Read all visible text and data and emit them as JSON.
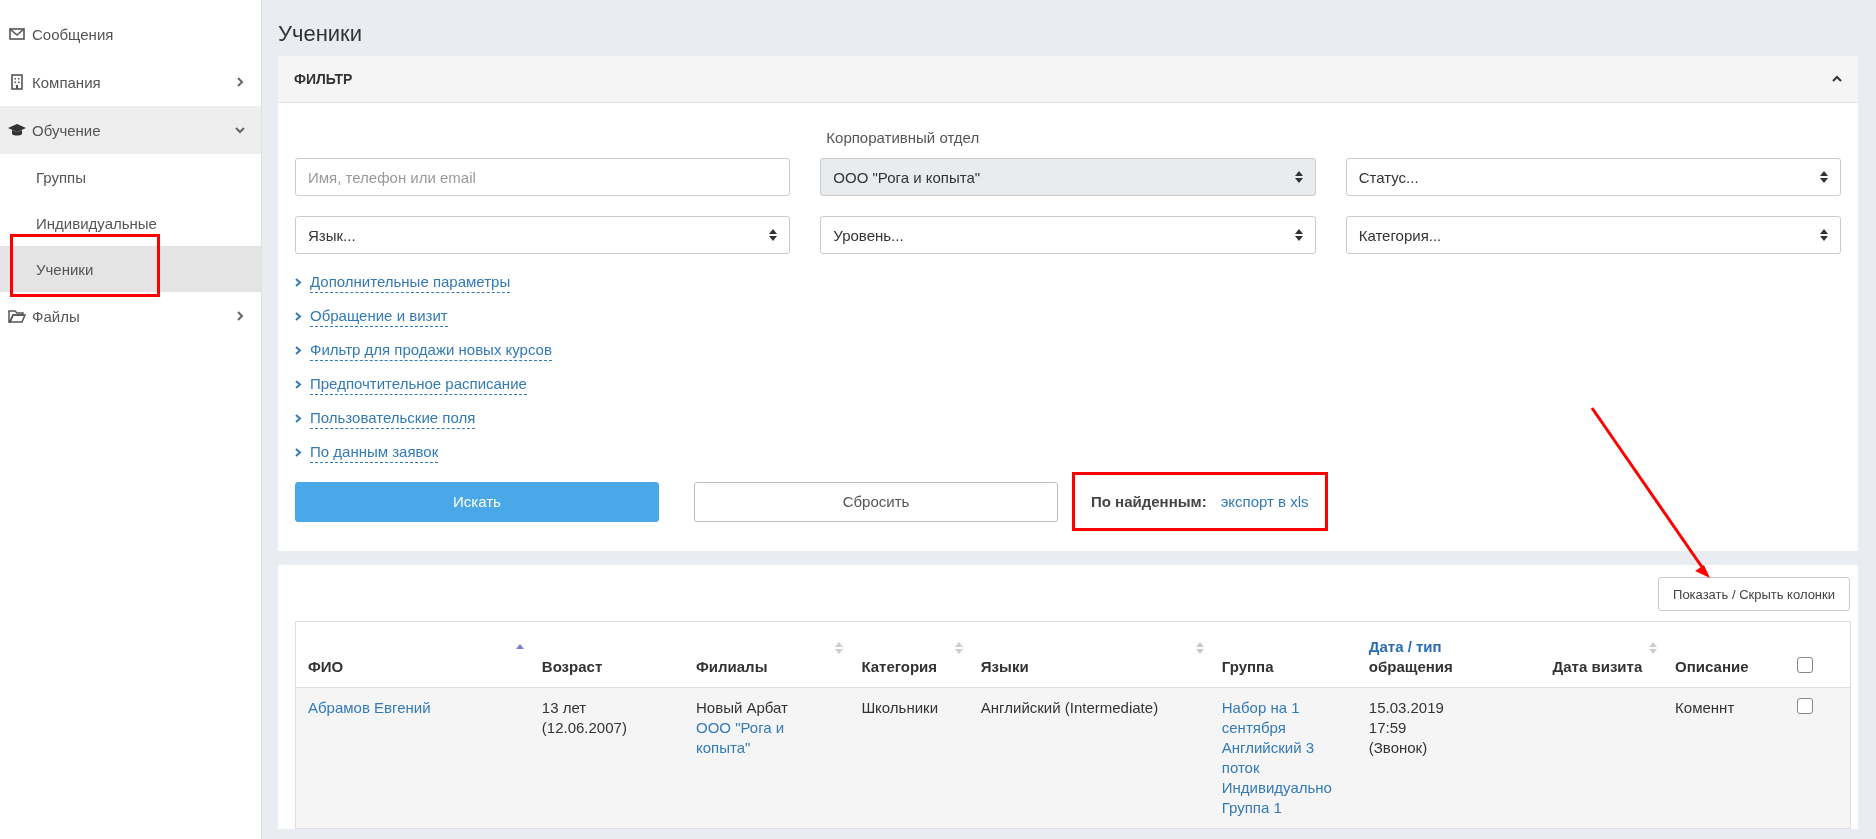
{
  "sidebar": {
    "items": [
      {
        "label": "Сообщения",
        "kind": "link",
        "selected": false
      },
      {
        "label": "Компания",
        "kind": "group",
        "expanded": false,
        "selected": false
      },
      {
        "label": "Обучение",
        "kind": "group",
        "expanded": true,
        "selected": true,
        "children": [
          {
            "label": "Группы",
            "selected": false
          },
          {
            "label": "Индивидуальные",
            "selected": false
          },
          {
            "label": "Ученики",
            "selected": true
          }
        ]
      },
      {
        "label": "Файлы",
        "kind": "group",
        "expanded": false,
        "selected": false
      }
    ]
  },
  "page": {
    "title": "Ученики"
  },
  "filter": {
    "title": "ФИЛЬТР",
    "expanded": true,
    "fields": [
      {
        "kind": "text",
        "placeholder": "Имя, телефон или email"
      },
      {
        "kind": "select",
        "label": "Корпоративный отдел",
        "value": "ООО \"Рога и копыта\"",
        "disabled": true
      },
      {
        "kind": "select",
        "value": "Статус...",
        "disabled": false
      },
      {
        "kind": "select",
        "value": "Язык...",
        "disabled": false
      },
      {
        "kind": "select",
        "value": "Уровень...",
        "disabled": false
      },
      {
        "kind": "select",
        "value": "Категория...",
        "disabled": false
      }
    ],
    "more_links": [
      "Дополнительные параметры",
      "Обращение и визит",
      "Фильтр для продажи новых курсов",
      "Предпочтительное расписание",
      "Пользовательские поля",
      "По данным заявок"
    ],
    "search_button": "Искать",
    "reset_button": "Сбросить",
    "export": {
      "label": "По найденным:",
      "link": "экспорт в xls"
    }
  },
  "table": {
    "columns_button": "Показать / Скрыть колонки",
    "columns": [
      {
        "kind": "text",
        "label": "ФИО",
        "sorted": true
      },
      {
        "kind": "text",
        "label": "Возраст"
      },
      {
        "kind": "text",
        "label": "Филиалы",
        "sorted": false
      },
      {
        "kind": "text",
        "label": "Категория",
        "sorted": false
      },
      {
        "kind": "text",
        "label": "Языки",
        "sorted": false
      },
      {
        "kind": "text",
        "label": "Группа"
      },
      {
        "kind": "text",
        "link": "Дата / тип",
        "label": "обращения"
      },
      {
        "kind": "text",
        "label": "Дата визита",
        "sorted": false
      },
      {
        "kind": "text",
        "label": "Описание"
      },
      {
        "kind": "checkbox",
        "checked": false
      }
    ],
    "rows": [
      {
        "cells": [
          {
            "kind": "parts",
            "parts": [
              {
                "kind": "link",
                "text": "Абрамов Евгений"
              }
            ]
          },
          {
            "kind": "parts",
            "parts": [
              {
                "kind": "text",
                "text": "13 лет"
              },
              {
                "kind": "text",
                "text": "(12.06.2007)"
              }
            ]
          },
          {
            "kind": "parts",
            "parts": [
              {
                "kind": "text",
                "text": "Новый Арбат"
              },
              {
                "kind": "link",
                "text": "ООО \"Рога и копыта\""
              }
            ]
          },
          {
            "kind": "parts",
            "parts": [
              {
                "kind": "text",
                "text": "Школьники"
              }
            ]
          },
          {
            "kind": "parts",
            "parts": [
              {
                "kind": "text",
                "text": "Английский (Intermediate)"
              }
            ]
          },
          {
            "kind": "parts",
            "parts": [
              {
                "kind": "link",
                "text": "Набор на 1 сентября"
              },
              {
                "kind": "link",
                "text": "Английский 3 поток"
              },
              {
                "kind": "link",
                "text": "Индивидуально"
              },
              {
                "kind": "link",
                "text": "Группа 1"
              }
            ]
          },
          {
            "kind": "parts",
            "parts": [
              {
                "kind": "text",
                "text": "15.03.2019"
              },
              {
                "kind": "text",
                "text": "17:59"
              },
              {
                "kind": "text",
                "text": "(Звонок)"
              }
            ]
          },
          {
            "kind": "empty"
          },
          {
            "kind": "parts",
            "parts": [
              {
                "kind": "text",
                "text": "Коменнт"
              }
            ]
          },
          {
            "kind": "checkbox",
            "checked": false
          }
        ]
      }
    ]
  }
}
